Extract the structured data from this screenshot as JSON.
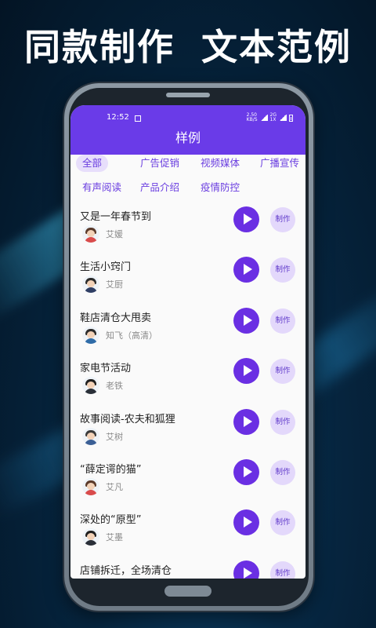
{
  "headline": {
    "left": "同款制作",
    "right": "文本范例"
  },
  "status_bar": {
    "time": "12:52",
    "net_speed": "2.50",
    "net_unit": "KB/S",
    "network_1": "2G",
    "network_2": "1X"
  },
  "app": {
    "title": "样例"
  },
  "tabs": [
    "全部",
    "广告促销",
    "视频媒体",
    "广播宣传",
    "有声阅读",
    "产品介绍",
    "疫情防控"
  ],
  "active_tab": "全部",
  "button_labels": {
    "make": "制作"
  },
  "items": [
    {
      "title": "又是一年春节到",
      "author": "艾媛",
      "avatar": "female-avatar-icon"
    },
    {
      "title": "生活小窍门",
      "author": "艾厨",
      "avatar": "male-avatar-icon"
    },
    {
      "title": "鞋店清仓大甩卖",
      "author": "知飞（高清）",
      "avatar": "male-avatar-icon"
    },
    {
      "title": "家电节活动",
      "author": "老铁",
      "avatar": "male-avatar-icon"
    },
    {
      "title": "故事阅读-农夫和狐狸",
      "author": "艾树",
      "avatar": "male-avatar-icon"
    },
    {
      "title": "“薛定谔的猫”",
      "author": "艾凡",
      "avatar": "female-avatar-icon"
    },
    {
      "title": "深处的“原型”",
      "author": "艾墨",
      "avatar": "male-avatar-icon"
    },
    {
      "title": "店铺拆迁，全场清仓",
      "author": "",
      "avatar": ""
    }
  ],
  "colors": {
    "accent": "#6a3be8",
    "play": "#6a2fe3",
    "tab_active_bg": "#e7defb",
    "make_bg": "#e3d8fb"
  }
}
